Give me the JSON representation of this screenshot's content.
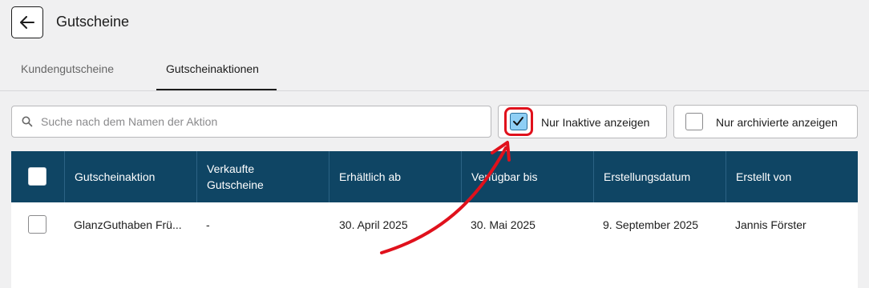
{
  "header": {
    "title": "Gutscheine",
    "back_icon": "arrow-left-icon"
  },
  "tabs": [
    {
      "label": "Kundengutscheine",
      "active": false
    },
    {
      "label": "Gutscheinaktionen",
      "active": true
    }
  ],
  "search": {
    "placeholder": "Suche nach dem Namen der Aktion",
    "value": ""
  },
  "filters": [
    {
      "label": "Nur Inaktive anzeigen",
      "checked": true
    },
    {
      "label": "Nur archivierte anzeigen",
      "checked": false
    }
  ],
  "table": {
    "columns": [
      "Gutscheinaktion",
      "Verkaufte Gutscheine",
      "Erhältlich ab",
      "Verfügbar bis",
      "Erstellungsdatum",
      "Erstellt von"
    ],
    "rows": [
      {
        "name": "GlanzGuthaben Frü...",
        "sold": "-",
        "available_from": "30. April 2025",
        "available_until": "30. Mai 2025",
        "created": "9. September 2025",
        "created_by": "Jannis Förster"
      }
    ]
  },
  "colors": {
    "header_bg": "#0f4564",
    "highlight": "#e0111c",
    "checkbox_checked": "#8fcff5"
  }
}
